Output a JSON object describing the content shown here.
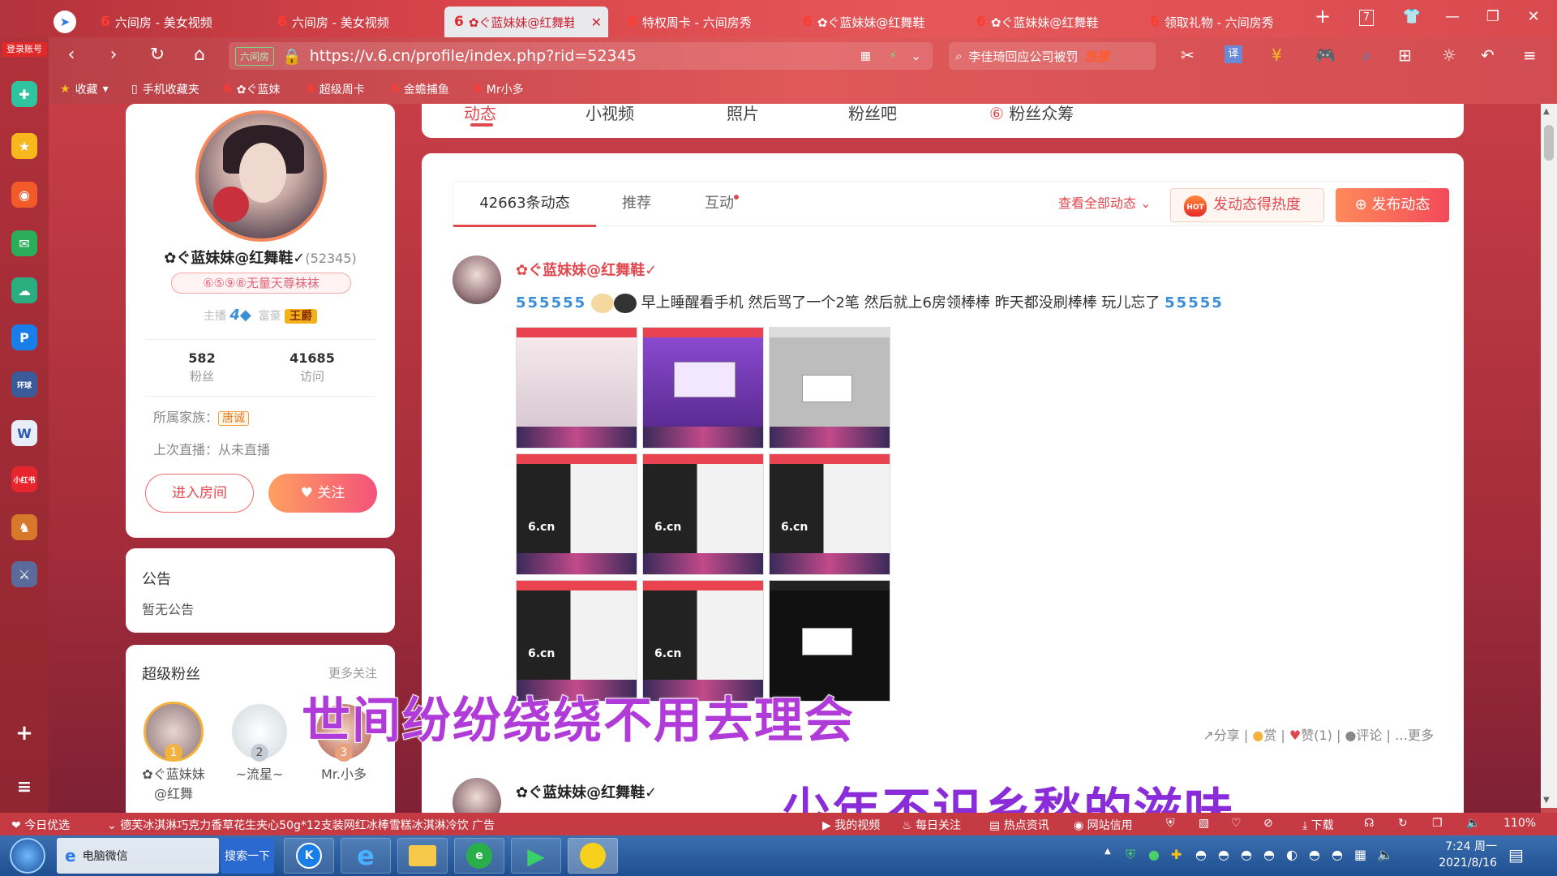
{
  "browser": {
    "login_badge": "登录账号",
    "tabs": [
      {
        "label": "六间房 - 美女视频",
        "active": false
      },
      {
        "label": "六间房 - 美女视频",
        "active": false
      },
      {
        "label": "✿ぐ蓝妹妹@红舞鞋",
        "active": true
      },
      {
        "label": "特权周卡 - 六间房秀",
        "active": false
      },
      {
        "label": "✿ぐ蓝妹妹@红舞鞋",
        "active": false
      },
      {
        "label": "✿ぐ蓝妹妹@红舞鞋",
        "active": false
      },
      {
        "label": "领取礼物 - 六间房秀",
        "active": false
      }
    ],
    "tab_count": "7",
    "url_badge": "六间房",
    "url": "https://v.6.cn/profile/index.php?rid=52345",
    "search_text": "李佳琦回应公司被罚",
    "search_hot": "热搜",
    "bookmarks": [
      "收藏",
      "手机收藏夹",
      "✿ぐ蓝妹",
      "超级周卡",
      "金蟾捕鱼",
      "Mr小多"
    ]
  },
  "profile": {
    "name": "✿ぐ蓝妹妹@红舞鞋✓",
    "rid": "(52345)",
    "nickname_badge": "⑥⑤⑨⑧无量天尊袜袜",
    "anchor_label": "主播",
    "anchor_level": "4",
    "rich_label": "富豪",
    "rich_badge": "王爵",
    "fans_count": "582",
    "fans_label": "粉丝",
    "visits_count": "41685",
    "visits_label": "访问",
    "family_label": "所属家族：",
    "family_tag": "唐诚",
    "last_live": "上次直播：从未直播",
    "enter_room": "进入房间",
    "follow": "关注"
  },
  "notice": {
    "title": "公告",
    "content": "暂无公告"
  },
  "super_fans": {
    "title": "超级粉丝",
    "more": "更多关注",
    "fans": [
      {
        "rank": "1",
        "name": "✿ぐ蓝妹妹@红舞"
      },
      {
        "rank": "2",
        "name": "~流星~"
      },
      {
        "rank": "3",
        "name": "Mr.小多"
      }
    ]
  },
  "top_tabs": [
    "动态",
    "小视频",
    "照片",
    "粉丝吧",
    "粉丝众筹"
  ],
  "feed": {
    "tabs": [
      {
        "label": "42663条动态",
        "active": true
      },
      {
        "label": "推荐",
        "active": false
      },
      {
        "label": "互动",
        "active": false
      }
    ],
    "view_all": "查看全部动态",
    "hot_button": "发动态得热度",
    "hot_icon": "HOT",
    "post_button": "发布动态",
    "post": {
      "author": "✿ぐ蓝妹妹@红舞鞋✓",
      "text": "早上睡醒看手机 然后骂了一个2笔 然后就上6房领棒棒 昨天都没刷棒棒 玩儿忘了",
      "images": [
        "light",
        "purple",
        "grey",
        "dark",
        "dark",
        "dark",
        "dark",
        "dark",
        "black"
      ],
      "logo": "6.cn",
      "actions": {
        "share": "分享",
        "reward": "赏",
        "like": "赞(1)",
        "comment": "评论",
        "more": "更多"
      }
    },
    "post2": {
      "author": "✿ぐ蓝妹妹@红舞鞋✓"
    }
  },
  "subtitles": [
    "世间纷纷绕绕不用去理会",
    "少年不识乡愁的滋味"
  ],
  "statusbar": {
    "promo": "今日优选",
    "ad": "德芙冰淇淋巧克力香草花生夹心50g*12支装网红冰棒雪糕冰淇淋冷饮",
    "ad_tag": "广告",
    "items": [
      "我的视频",
      "每日关注",
      "热点资讯",
      "网站信用",
      "下载"
    ],
    "zoom": "110%"
  },
  "taskbar": {
    "wechat": "电脑微信",
    "search": "搜索一下",
    "time": "7:24 周一",
    "date": "2021/8/16"
  },
  "colors": {
    "accent": "#e0494f",
    "brand_gradient": "#c94a4f"
  }
}
